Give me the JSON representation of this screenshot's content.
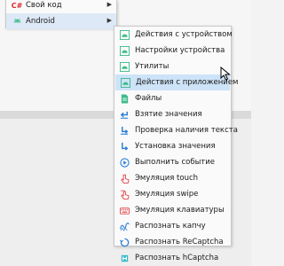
{
  "parent_menu": {
    "items": [
      {
        "label": "Свой код",
        "icon": "csharp-icon",
        "icon_text": "C#",
        "has_submenu": true
      },
      {
        "label": "Android",
        "icon": "android-icon",
        "has_submenu": true,
        "highlighted": true
      }
    ]
  },
  "submenu": {
    "items": [
      {
        "label": "Действия с устройством",
        "icon": "android-device-icon"
      },
      {
        "label": "Настройки устройства",
        "icon": "android-settings-icon"
      },
      {
        "label": "Утилиты",
        "icon": "android-utilities-icon"
      },
      {
        "label": "Действия с приложением",
        "icon": "android-app-icon",
        "selected": true
      },
      {
        "label": "Файлы",
        "icon": "file-icon"
      },
      {
        "label": "Взятие значения",
        "icon": "get-value-icon"
      },
      {
        "label": "Проверка наличия текста",
        "icon": "check-text-icon"
      },
      {
        "label": "Установка значения",
        "icon": "set-value-icon"
      },
      {
        "label": "Выполнить событие",
        "icon": "execute-event-icon"
      },
      {
        "label": "Эмуляция touch",
        "icon": "touch-icon"
      },
      {
        "label": "Эмуляция swipe",
        "icon": "swipe-icon"
      },
      {
        "label": "Эмуляция клавиатуры",
        "icon": "keyboard-icon"
      },
      {
        "label": "Распознать капчу",
        "icon": "captcha-icon"
      },
      {
        "label": "Распознать ReCaptcha",
        "icon": "recaptcha-icon"
      },
      {
        "label": "Распознать hCaptcha",
        "icon": "hcaptcha-icon"
      }
    ]
  },
  "colors": {
    "android_green": "#3dbb8a",
    "blue": "#2f7fd6",
    "red": "#e0474c",
    "highlight": "#dde9f6",
    "selected": "#cde3f7"
  }
}
